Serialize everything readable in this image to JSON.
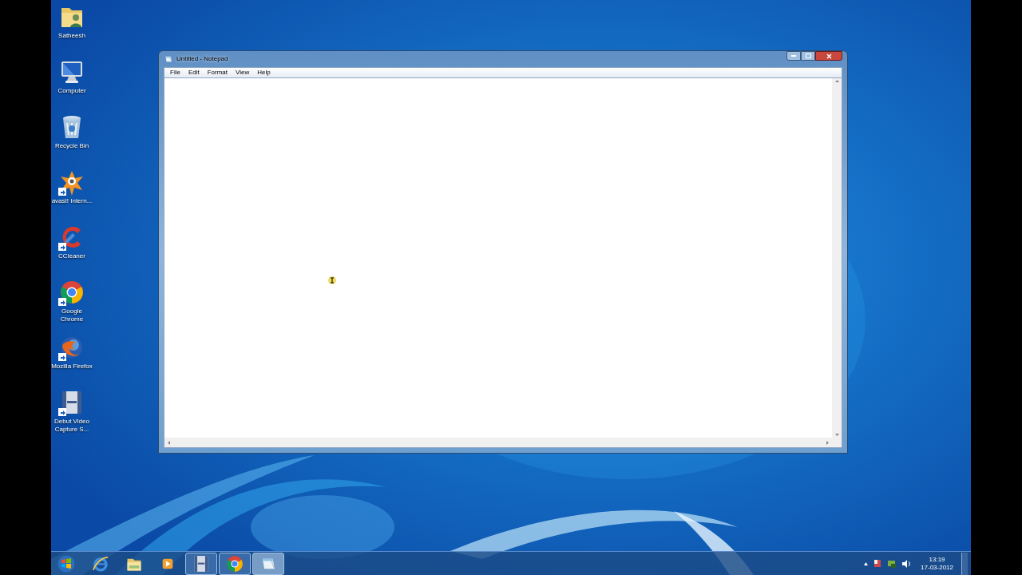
{
  "desktop_icons": [
    {
      "kind": "folder",
      "label": "Satheesh",
      "shortcut": false
    },
    {
      "kind": "computer",
      "label": "Computer",
      "shortcut": false
    },
    {
      "kind": "recycle",
      "label": "Recycle Bin",
      "shortcut": false
    },
    {
      "kind": "avast",
      "label": "avast! Intern...",
      "shortcut": true
    },
    {
      "kind": "ccleaner",
      "label": "CCleaner",
      "shortcut": true
    },
    {
      "kind": "chrome",
      "label": "Google Chrome",
      "shortcut": true
    },
    {
      "kind": "firefox",
      "label": "Mozilla Firefox",
      "shortcut": true
    },
    {
      "kind": "film",
      "label": "Debut Video Capture S...",
      "shortcut": true
    }
  ],
  "window": {
    "title": "Untitled - Notepad",
    "menu": [
      "File",
      "Edit",
      "Format",
      "View",
      "Help"
    ]
  },
  "taskbar": {
    "items": [
      {
        "kind": "ie",
        "running": false,
        "selected": false
      },
      {
        "kind": "explorer",
        "running": false,
        "selected": false
      },
      {
        "kind": "media",
        "running": false,
        "selected": false
      },
      {
        "kind": "film",
        "running": true,
        "selected": false
      },
      {
        "kind": "chrome",
        "running": true,
        "selected": false
      },
      {
        "kind": "notepad",
        "running": true,
        "selected": true
      }
    ],
    "tray": {
      "time": "13:19",
      "date": "17-03-2012"
    }
  }
}
